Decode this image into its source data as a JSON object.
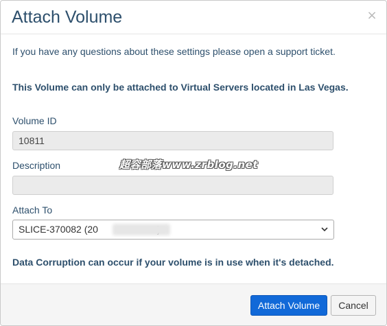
{
  "dialog": {
    "title": "Attach Volume",
    "close_icon": "×",
    "intro_text": "If you have any questions about these settings please open a support ticket.",
    "notice_text": "This Volume can only be attached to Virtual Servers located in Las Vegas.",
    "volume_id": {
      "label": "Volume ID",
      "value": "10811"
    },
    "description": {
      "label": "Description",
      "value": ""
    },
    "attach_to": {
      "label": "Attach To",
      "selected": "SLICE-370082 (20",
      "selected_suffix": ")"
    },
    "warning_text": "Data Corruption can occur if your volume is in use when it's detached.",
    "buttons": {
      "primary": "Attach Volume",
      "cancel": "Cancel"
    },
    "watermark": "超容部落www.zrblog.net"
  },
  "colors": {
    "title": "#2d4f6c",
    "primary_button": "#1169d8",
    "footer_bg": "#f5f5f5",
    "input_readonly_bg": "#ebebeb"
  },
  "icons": {
    "close": "close-icon",
    "select": "chevron-down-icon"
  }
}
